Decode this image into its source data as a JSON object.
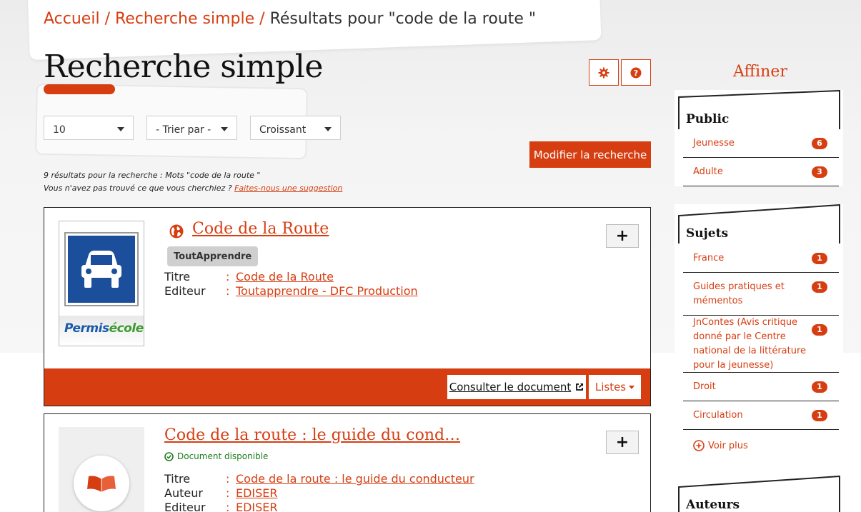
{
  "breadcrumb": {
    "home": "Accueil",
    "sep1": "/",
    "search": "Recherche simple",
    "sep2": "/",
    "current": "Résultats pour \"code de la route \""
  },
  "page_title": "Recherche simple",
  "toolbar": {
    "settings_icon": "gear-icon",
    "help_icon": "question-icon"
  },
  "filters": {
    "page_size": "10",
    "sort_by": "- Trier par -",
    "order": "Croissant"
  },
  "modify_button": "Modifier la recherche",
  "info": {
    "results_text": "9 résultats pour la recherche : Mots \"code de la route \"",
    "not_found_text": "Vous n'avez pas trouvé ce que vous cherchiez ?",
    "suggestion_link": "Faites-nous une suggestion"
  },
  "results": [
    {
      "title": "Code de la Route",
      "badge": "ToutApprendre",
      "thumb_logo_blue": "Permis",
      "thumb_logo_green": "école",
      "fields": [
        {
          "label": "Titre",
          "colon": ":",
          "value": "Code de la Route"
        },
        {
          "label": "Editeur",
          "colon": ":",
          "value": "Toutapprendre - DFC Production"
        }
      ],
      "consult_label": "Consulter le document",
      "lists_label": "Listes",
      "plus": "+"
    },
    {
      "title": "Code de la route : le guide du cond…",
      "availability": "Document disponible",
      "fields": [
        {
          "label": "Titre",
          "colon": ":",
          "value": "Code de la route : le guide du conducteur"
        },
        {
          "label": "Auteur",
          "colon": ":",
          "value": "EDISER"
        },
        {
          "label": "Editeur",
          "colon": ":",
          "value": "EDISER"
        }
      ],
      "plus": "+"
    }
  ],
  "sidebar": {
    "title": "Affiner",
    "facets": [
      {
        "title": "Public",
        "items": [
          {
            "label": "Jeunesse",
            "count": "6"
          },
          {
            "label": "Adulte",
            "count": "3"
          }
        ]
      },
      {
        "title": "Sujets",
        "items": [
          {
            "label": "France",
            "count": "1"
          },
          {
            "label": "Guides pratiques et mémentos",
            "count": "1"
          },
          {
            "label": "JnContes (Avis critique donné par le Centre national de la littérature pour la jeunesse)",
            "count": "1"
          },
          {
            "label": "Droit",
            "count": "1"
          },
          {
            "label": "Circulation",
            "count": "1"
          }
        ],
        "more": "Voir plus"
      },
      {
        "title": "Auteurs",
        "items": []
      }
    ]
  },
  "colors": {
    "accent": "#d63e12",
    "sign_blue": "#1b4f9b",
    "available_green": "#1e7e1e"
  }
}
